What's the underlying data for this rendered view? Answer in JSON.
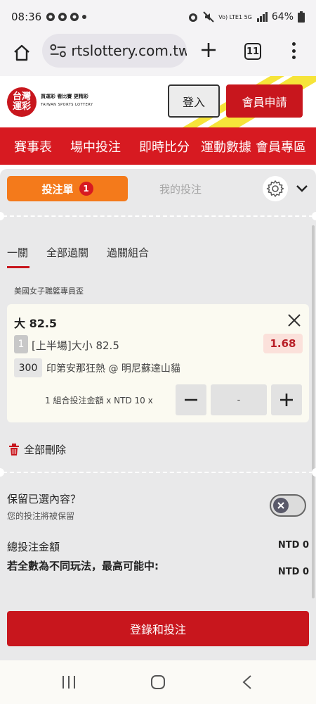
{
  "status_bar": {
    "time": "08:36",
    "signal": "Vo) LTE1 5G",
    "battery": "64%"
  },
  "browser": {
    "url": "rtslottery.com.tw",
    "tab_count": "11"
  },
  "header": {
    "logo_line1": "台灣",
    "logo_line2": "運彩",
    "slogan": "買運彩 看比賽 更精彩",
    "subtitle": "TAIWAN SPORTS LOTTERY",
    "login_label": "登入",
    "register_label": "會員申請"
  },
  "nav": {
    "items": [
      "賽事表",
      "場中投注",
      "即時比分",
      "運動數據",
      "會員專區"
    ]
  },
  "betslip": {
    "tab_label": "投注單",
    "badge_count": "1",
    "my_bets_label": "我的投注",
    "subtabs": [
      "一關",
      "全部過關",
      "過關組合"
    ],
    "league": "美國女子職籃專員盃",
    "bet": {
      "title": "大 82.5",
      "half_number": "1",
      "market": "[上半場]大小 82.5",
      "odds": "1.68",
      "match_code": "300",
      "match": "印第安那狂熱 @ 明尼蘇達山貓",
      "stake_label": "1 組合投注金額 x NTD 10 x",
      "stake_value": "-"
    },
    "delete_all_label": "全部刪除",
    "keep_title": "保留已選內容？",
    "keep_subtitle": "您的投注將被保留",
    "total_label": "總投注金額",
    "total_value": "NTD 0",
    "max_win_label": "若全數為不同玩法，最高可能中:",
    "max_win_value": "NTD 0",
    "submit_label": "登錄和投注"
  },
  "colors": {
    "brand_red": "#d71a21",
    "bet_orange": "#f47a1b",
    "odds_red": "#b81e26"
  }
}
